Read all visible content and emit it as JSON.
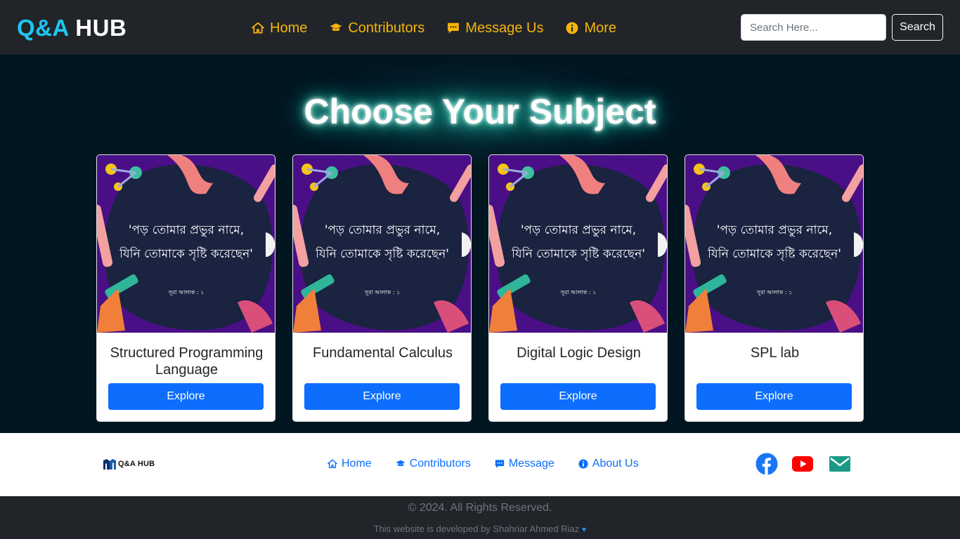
{
  "brand": {
    "part1": "Q&A",
    "part2": "HUB"
  },
  "nav": {
    "links": [
      {
        "label": "Home",
        "icon": "home-icon"
      },
      {
        "label": "Contributors",
        "icon": "graduation-cap-icon"
      },
      {
        "label": "Message Us",
        "icon": "chat-icon"
      },
      {
        "label": "More",
        "icon": "info-icon"
      }
    ],
    "search_placeholder": "Search Here...",
    "search_button": "Search"
  },
  "hero": {
    "title": "Choose Your Subject"
  },
  "cards": [
    {
      "title": "Structured Programming Language",
      "button": "Explore",
      "image_text_line1": "'পড় তোমার প্রভুর নামে,",
      "image_text_line2": "যিনি তোমাকে সৃষ্টি করেছেন'",
      "image_caption": "সূরা আলাক : ১"
    },
    {
      "title": "Fundamental Calculus",
      "button": "Explore",
      "image_text_line1": "'পড় তোমার প্রভুর নামে,",
      "image_text_line2": "যিনি তোমাকে সৃষ্টি করেছেন'",
      "image_caption": "সূরা আলাক : ১"
    },
    {
      "title": "Digital Logic Design",
      "button": "Explore",
      "image_text_line1": "'পড় তোমার প্রভুর নামে,",
      "image_text_line2": "যিনি তোমাকে সৃষ্টি করেছেন'",
      "image_caption": "সূরা আলাক : ১"
    },
    {
      "title": "SPL lab",
      "button": "Explore",
      "image_text_line1": "'পড় তোমার প্রভুর নামে,",
      "image_text_line2": "যিনি তোমাকে সৃষ্টি করেছেন'",
      "image_caption": "সূরা আলাক : ১"
    }
  ],
  "footer": {
    "logo_text": "Q&A HUB",
    "links": [
      {
        "label": "Home",
        "icon": "home-icon"
      },
      {
        "label": "Contributors",
        "icon": "graduation-cap-icon"
      },
      {
        "label": "Message",
        "icon": "chat-icon"
      },
      {
        "label": "About Us",
        "icon": "info-icon"
      }
    ],
    "social": [
      "facebook-icon",
      "youtube-icon",
      "mail-icon"
    ],
    "copyright": "© 2024. All Rights Reserved.",
    "credit": "This website is developed by Shahriar Ahmed Riaz"
  },
  "colors": {
    "nav_bg": "#212529",
    "brand_accent": "#1ec6f0",
    "nav_link": "#f5b50a",
    "hero_bg": "#011621",
    "primary": "#0d6efd",
    "card_img_bg": "#4a0f86"
  }
}
